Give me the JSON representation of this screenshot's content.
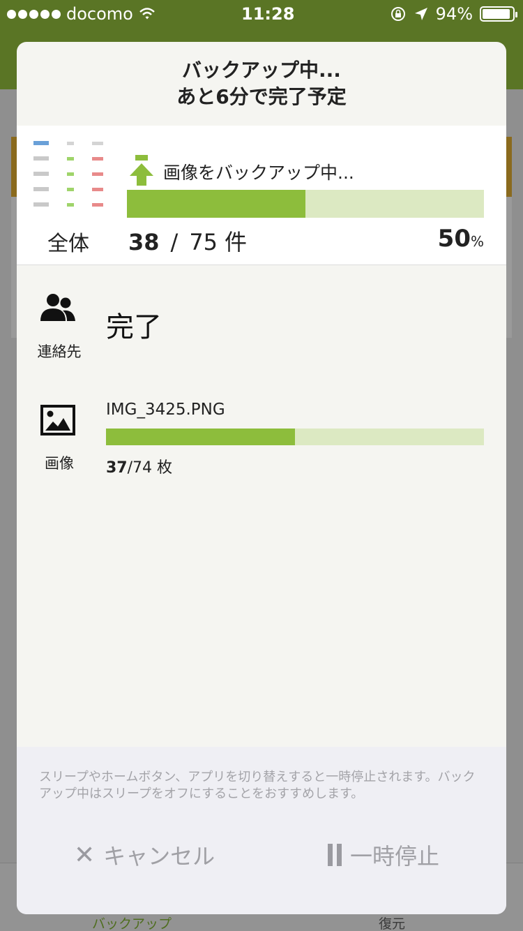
{
  "status_bar": {
    "carrier": "docomo",
    "time": "11:28",
    "battery": "94%"
  },
  "background_app": {
    "tab_backup": "バックアップ",
    "tab_restore": "復元"
  },
  "modal": {
    "title_line1": "バックアップ中...",
    "title_line2": "あと6分で完了予定",
    "overall": {
      "uploading_label": "画像をバックアップ中...",
      "progress_fraction": 0.5,
      "label": "全体",
      "done": "38",
      "separator": "/",
      "total": "75",
      "unit": "件",
      "percent_value": "50",
      "percent_sign": "%"
    },
    "contacts": {
      "label": "連絡先",
      "status": "完了"
    },
    "images": {
      "label": "画像",
      "filename": "IMG_3425.PNG",
      "progress_fraction": 0.5,
      "done": "37",
      "total_text": "/74 枚"
    },
    "notice": "スリープやホームボタン、アプリを切り替えすると一時停止されます。バックアップ中はスリープをオフにすることをおすすめします。",
    "cancel_label": "キャンセル",
    "pause_label": "一時停止"
  },
  "colors": {
    "progress_fill": "#8dbd3c",
    "progress_track": "#dce9c2",
    "header_green": "#5a7525"
  }
}
